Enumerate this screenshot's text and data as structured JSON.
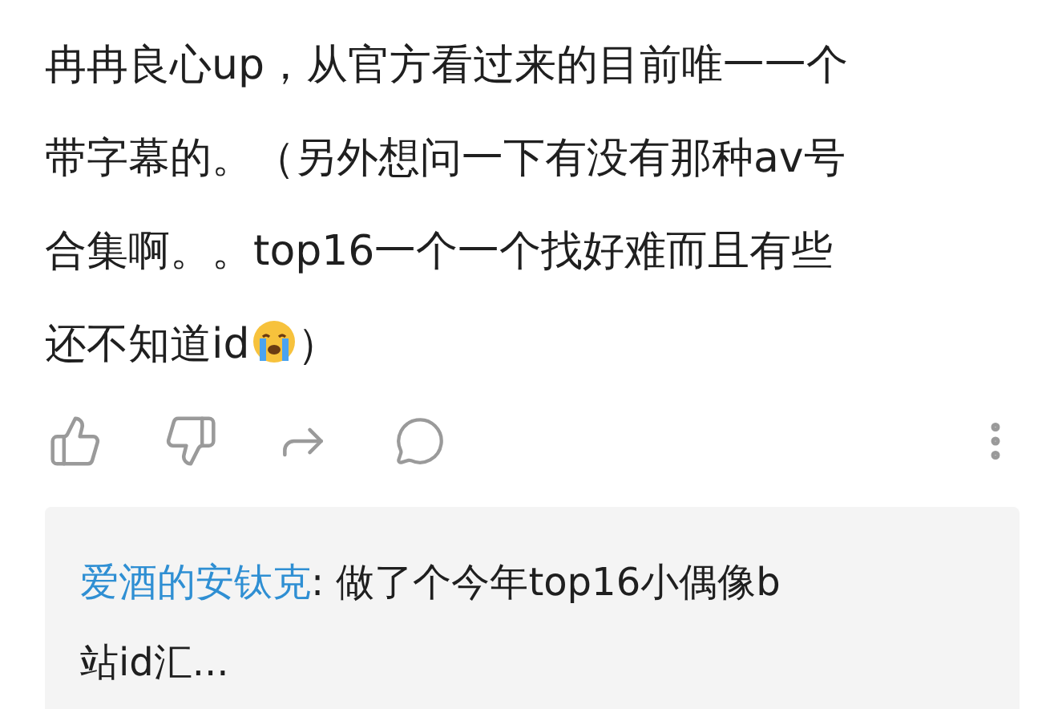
{
  "comment": {
    "lines": [
      "冉冉良心up，从官方看过来的目前唯一一个",
      "带字幕的。（另外想问一下有没有那种av号",
      "合集啊。。top16一个一个找好难而且有些"
    ],
    "last_line": {
      "before": "还不知道id",
      "after": "）"
    }
  },
  "reply": {
    "author": "爱酒的安钛克",
    "lines": [
      ": 做了个今年top16小偶像b",
      "站id汇..."
    ]
  }
}
